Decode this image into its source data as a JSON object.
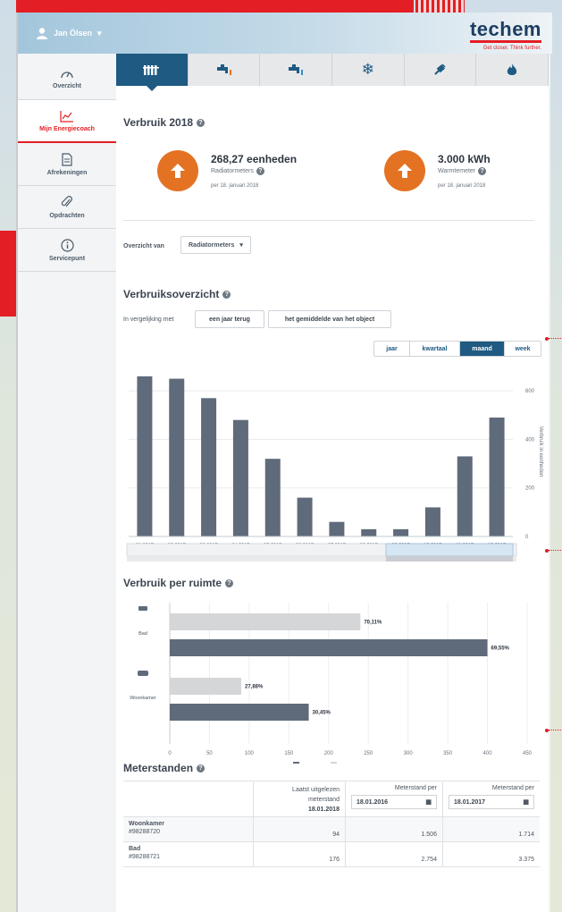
{
  "header": {
    "user_name": "Jan Ölsen",
    "logo": "techem",
    "tagline": "Get closer. Think further."
  },
  "sidebar": {
    "items": [
      {
        "label": "Overzicht",
        "icon": "gauge-icon"
      },
      {
        "label": "Mijn Energiecoach",
        "icon": "chart-icon",
        "active": true
      },
      {
        "label": "Afrekeningen",
        "icon": "document-icon"
      },
      {
        "label": "Opdrachten",
        "icon": "paperclip-icon"
      },
      {
        "label": "Servicepunt",
        "icon": "info-icon"
      }
    ]
  },
  "tabs": [
    {
      "icon": "radiator-icon",
      "active": true
    },
    {
      "icon": "hot-water-tap-icon"
    },
    {
      "icon": "cold-water-tap-icon"
    },
    {
      "icon": "snowflake-icon"
    },
    {
      "icon": "plug-icon"
    },
    {
      "icon": "flame-icon"
    }
  ],
  "verbruik": {
    "title": "Verbruik 2018",
    "kpi1": {
      "value": "268,27 eenheden",
      "label": "Radiatormeters",
      "date": "per 18. januari 2018"
    },
    "kpi2": {
      "value": "3.000 kWh",
      "label": "Warmtemeter",
      "date": "per 18. januari 2018"
    }
  },
  "overzicht": {
    "label": "Overzicht van",
    "selected": "Radiatormeters"
  },
  "verbruiksoverzicht": {
    "title": "Verbruiksoverzicht",
    "compare_label": "In vergelijking met",
    "btn_year": "een jaar terug",
    "btn_avg": "het gemiddelde van het object",
    "periods": [
      "jaar",
      "kwartaal",
      "maand",
      "week"
    ],
    "active_period": "maand",
    "ylabel": "Verbruik in eenheden"
  },
  "ruimte": {
    "title": "Verbruik per ruimte",
    "legend": [
      "2018",
      "2017"
    ]
  },
  "meterstanden": {
    "title": "Meterstanden",
    "col1": "Laatst uitgelezen meterstand",
    "col1_date": "18.01.2018",
    "col2": "Meterstand per",
    "col2_date": "18.01.2016",
    "col3": "Meterstand per",
    "col3_date": "18.01.2017",
    "rows": [
      {
        "room": "Woonkamer",
        "id": "#98288720",
        "last": "94",
        "v2016": "1.506",
        "v2017": "1.714"
      },
      {
        "room": "Bad",
        "id": "#98288721",
        "last": "176",
        "v2016": "2.754",
        "v2017": "3.375"
      }
    ]
  },
  "chart_data": [
    {
      "type": "bar",
      "title": "Verbruiksoverzicht",
      "categories": [
        "01.2017",
        "02.2017",
        "03.2017",
        "04.2017",
        "05.2017",
        "06.2017",
        "07.2017",
        "08.2017",
        "09.2017",
        "10.2017",
        "11.2017",
        "12.2017"
      ],
      "values": [
        660,
        650,
        570,
        480,
        320,
        160,
        60,
        30,
        30,
        120,
        330,
        490
      ],
      "ylabel": "Verbruik in eenheden",
      "ylim": [
        0,
        700
      ],
      "yticks": [
        0,
        200,
        400,
        600
      ],
      "color": "#5f6b7a",
      "grid": true
    },
    {
      "type": "bar",
      "orientation": "horizontal",
      "title": "Verbruik per ruimte",
      "categories": [
        "Bad",
        "Woonkamer"
      ],
      "series": [
        {
          "name": "2017",
          "values": [
            240,
            90
          ],
          "labels": [
            "70,11%",
            "27,88%"
          ],
          "color": "#d4d6d8"
        },
        {
          "name": "2018",
          "values": [
            400,
            175
          ],
          "labels": [
            "69,55%",
            "30,45%"
          ],
          "color": "#5f6b7a"
        }
      ],
      "xlim": [
        0,
        450
      ],
      "xticks": [
        0,
        50,
        100,
        150,
        200,
        250,
        300,
        350,
        400,
        450
      ],
      "legend": "bottom"
    }
  ]
}
